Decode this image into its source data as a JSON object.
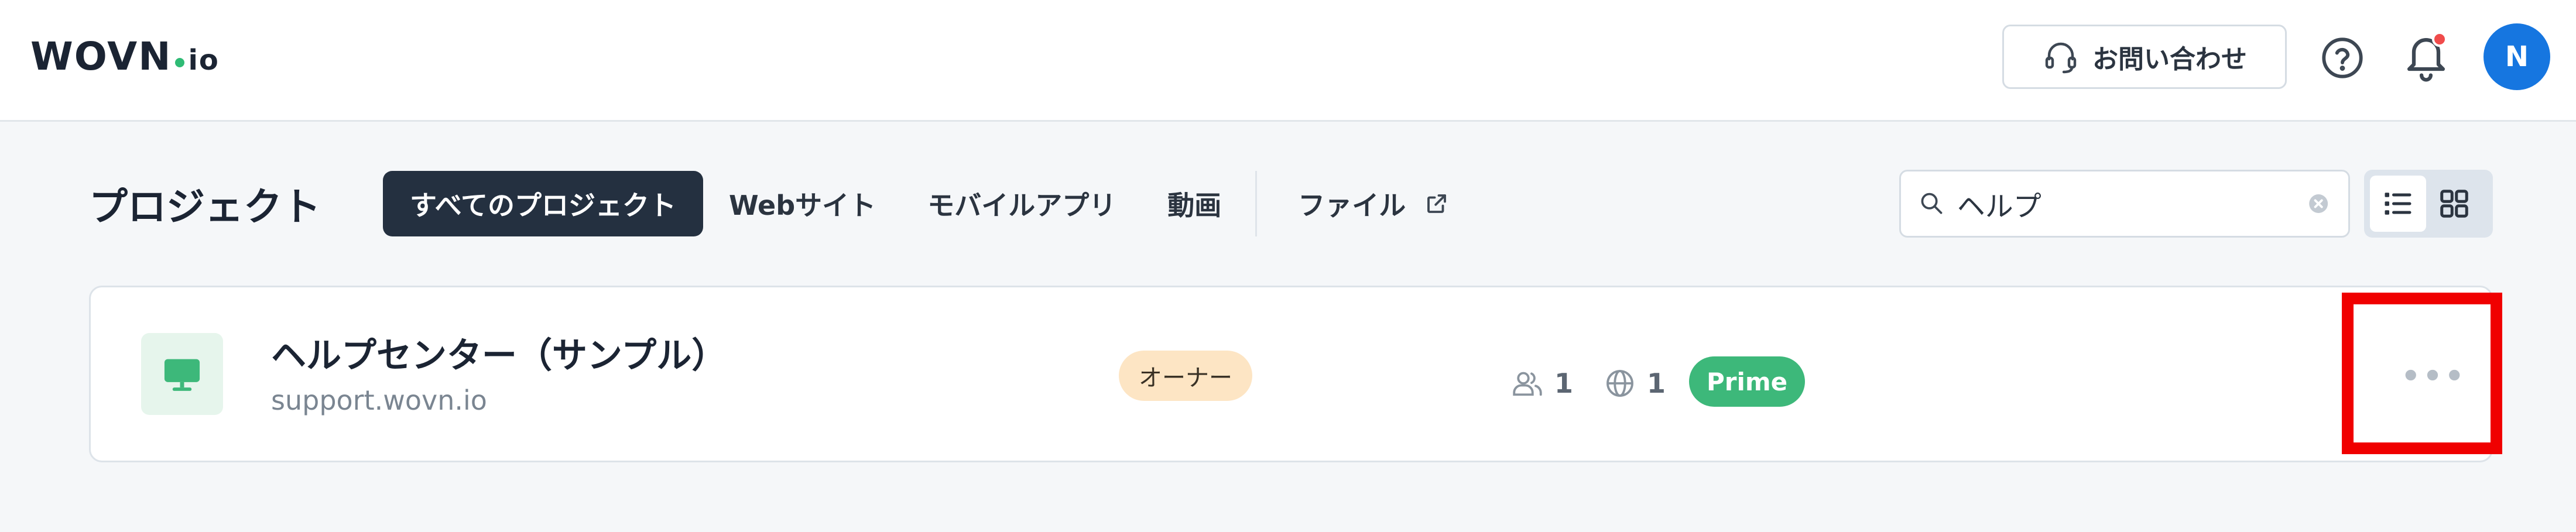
{
  "header": {
    "logo_main": "WOVN",
    "logo_suffix": "io",
    "contact_label": "お問い合わせ",
    "contact_icon": "headset-icon",
    "help_icon": "question-circle-icon",
    "notification_icon": "bell-icon",
    "avatar_initial": "N"
  },
  "toolbar": {
    "title": "プロジェクト",
    "tabs": [
      {
        "label": "すべてのプロジェクト",
        "active": true
      },
      {
        "label": "Webサイト",
        "active": false
      },
      {
        "label": "モバイルアプリ",
        "active": false
      },
      {
        "label": "動画",
        "active": false
      },
      {
        "label": "ファイル",
        "active": false,
        "icon": "external-link-icon"
      }
    ],
    "search": {
      "value": "ヘルプ",
      "icon": "search-icon",
      "clear_icon": "clear-circle-icon"
    },
    "view": {
      "selected": "list",
      "options": [
        "list",
        "grid"
      ]
    }
  },
  "projects": [
    {
      "icon": "monitor-icon",
      "name": "ヘルプセンター（サンプル）",
      "url": "support.wovn.io",
      "role": "オーナー",
      "members": "1",
      "languages": "1",
      "plan": "Prime",
      "menu_icon": "more-horizontal-icon"
    }
  ],
  "colors": {
    "accent": "#1676e0",
    "active_tab": "#243040",
    "plan_badge": "#3db87a",
    "role_badge": "#fde5c4",
    "highlight": "#f00000",
    "notification_dot": "#f04b4b"
  }
}
